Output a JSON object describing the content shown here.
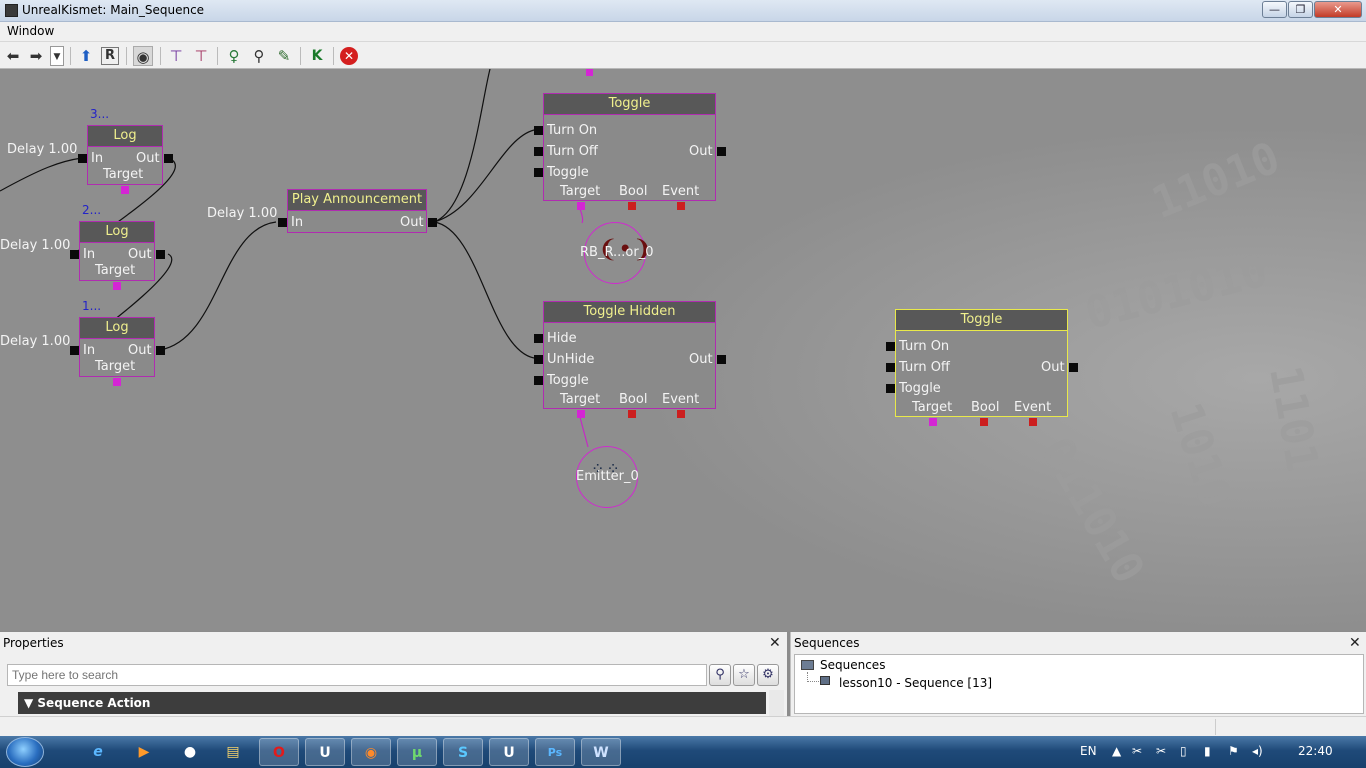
{
  "window": {
    "title": "UnrealKismet: Main_Sequence",
    "minimize": "—",
    "maximize": "❐",
    "close": "✕"
  },
  "menu": {
    "window": "Window"
  },
  "toolbar": {
    "icons": [
      "back-icon",
      "forward-icon",
      "history-dropdown-icon",
      "parent-sequence-icon",
      "rename-icon",
      "view-icon",
      "expand-icon",
      "collapse-icon",
      "light-icon",
      "search-icon",
      "tool-icon",
      "kismet-icon",
      "stop-icon"
    ]
  },
  "canvas": {
    "log_nodes": [
      {
        "index": "3...",
        "title": "Log",
        "in": "In",
        "out": "Out",
        "target": "Target",
        "delay": "Delay 1.00"
      },
      {
        "index": "2...",
        "title": "Log",
        "in": "In",
        "out": "Out",
        "target": "Target",
        "delay": "Delay 1.00"
      },
      {
        "index": "1...",
        "title": "Log",
        "in": "In",
        "out": "Out",
        "target": "Target",
        "delay": "Delay 1.00"
      }
    ],
    "play_announcement": {
      "title": "Play Announcement",
      "in": "In",
      "out": "Out",
      "delay": "Delay 1.00"
    },
    "toggle_top": {
      "title": "Toggle",
      "inputs": [
        "Turn On",
        "Turn Off",
        "Toggle"
      ],
      "out": "Out",
      "vars": [
        "Target",
        "Bool",
        "Event"
      ]
    },
    "toggle_hidden": {
      "title": "Toggle Hidden",
      "inputs": [
        "Hide",
        "UnHide",
        "Toggle"
      ],
      "out": "Out",
      "vars": [
        "Target",
        "Bool",
        "Event"
      ]
    },
    "toggle_selected": {
      "title": "Toggle",
      "inputs": [
        "Turn On",
        "Turn Off",
        "Toggle"
      ],
      "out": "Out",
      "vars": [
        "Target",
        "Bool",
        "Event"
      ]
    },
    "var_rb": "RB_R...or_0",
    "var_emitter": "Emitter_0"
  },
  "properties": {
    "title": "Properties",
    "close": "✕",
    "search_placeholder": "Type here to search",
    "category": "Sequence Action"
  },
  "sequences": {
    "title": "Sequences",
    "close": "✕",
    "root": "Sequences",
    "child": "lesson10 - Sequence [13]"
  },
  "taskbar": {
    "language": "EN",
    "time": "22:40",
    "apps": [
      "ie-icon",
      "media-icon",
      "app-icon",
      "explorer-icon",
      "opera-icon",
      "unreal-icon",
      "firefox-icon",
      "utorrent-icon",
      "skype-icon",
      "unreal-editor-icon",
      "photoshop-icon",
      "word-icon"
    ]
  },
  "colors": {
    "node_border": "#b02cb0",
    "selected_border": "#e9e94a",
    "title_text": "#f0f08e",
    "target_pin": "#d426d4",
    "bool_pin": "#cc1f1f"
  }
}
